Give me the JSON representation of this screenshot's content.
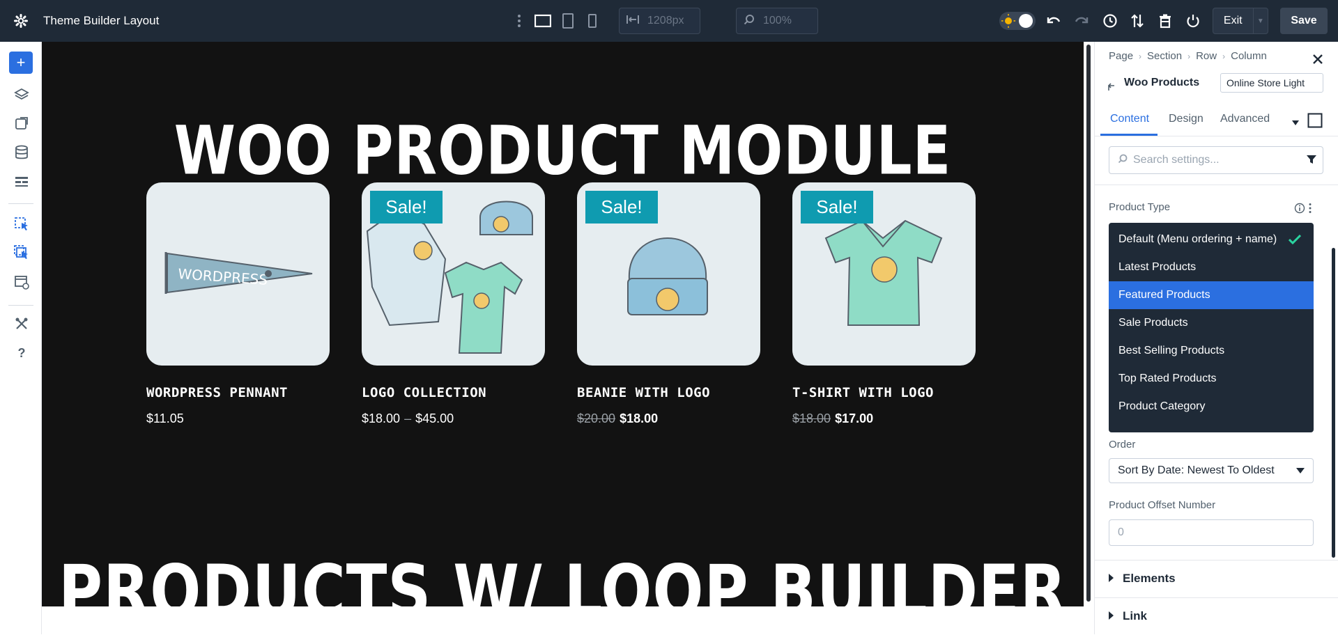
{
  "app": {
    "title": "Theme Builder Layout"
  },
  "toolbar": {
    "width_value": "1208px",
    "zoom_value": "100%",
    "exit_label": "Exit",
    "save_label": "Save"
  },
  "canvas": {
    "heading_1": "WOO PRODUCT MODULE",
    "heading_2": "PRODUCTS W/ LOOP BUILDER",
    "products": [
      {
        "name": "WordPress Pennant",
        "sale": "",
        "price_old": "",
        "price_new": "$11.05",
        "price_range_low": "",
        "price_range_high": ""
      },
      {
        "name": "Logo Collection",
        "sale": "Sale!",
        "price_old": "",
        "price_new": "",
        "price_range_low": "$18.00",
        "price_range_high": "$45.00"
      },
      {
        "name": "Beanie with Logo",
        "sale": "Sale!",
        "price_old": "$20.00",
        "price_new": "$18.00",
        "price_range_low": "",
        "price_range_high": ""
      },
      {
        "name": "T-Shirt with Logo",
        "sale": "Sale!",
        "price_old": "$18.00",
        "price_new": "$17.00",
        "price_range_low": "",
        "price_range_high": ""
      }
    ],
    "range_separator": "–"
  },
  "panel": {
    "breadcrumb": [
      "Page",
      "Section",
      "Row",
      "Column"
    ],
    "module_title": "Woo Products",
    "preset": "Online Store Light",
    "tabs": [
      "Content",
      "Design",
      "Advanced"
    ],
    "search_placeholder": "Search settings...",
    "product_type_label": "Product Type",
    "product_type_options": [
      "Default (Menu ordering + name)",
      "Latest Products",
      "Featured Products",
      "Sale Products",
      "Best Selling Products",
      "Top Rated Products",
      "Product Category"
    ],
    "order_label": "Order",
    "order_value": "Sort By Date: Newest To Oldest",
    "offset_label": "Product Offset Number",
    "offset_placeholder": "0",
    "accordions": [
      "Elements",
      "Link"
    ]
  },
  "colors": {
    "accent": "#2b6fe0",
    "topbar": "#1f2a37",
    "canvas_bg": "#121212",
    "sale_badge": "#0f9bb0",
    "check": "#2bd4a0"
  }
}
